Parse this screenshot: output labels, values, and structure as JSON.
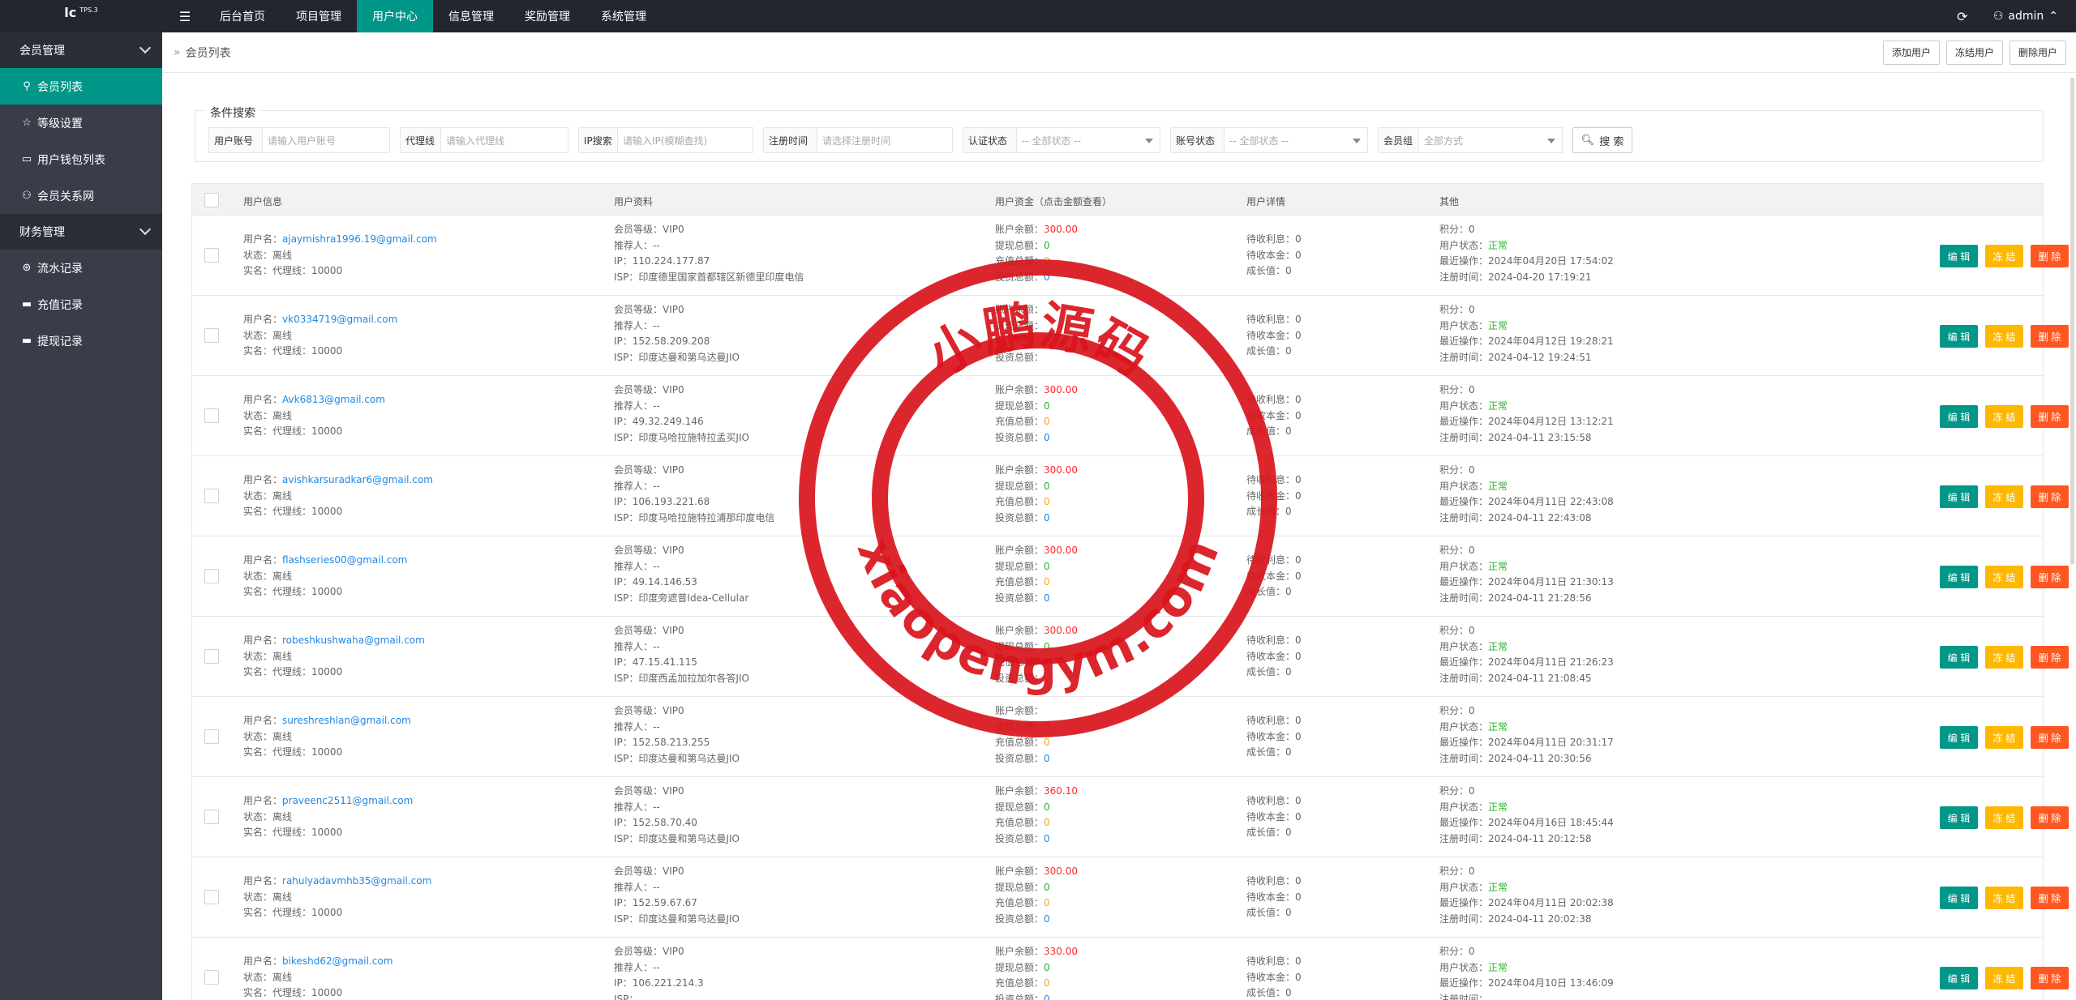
{
  "topbar": {
    "logo_text": "lc",
    "logo_version": "TPS.3",
    "menu_icon": "hamburger-icon",
    "nav": [
      "后台首页",
      "项目管理",
      "用户中心",
      "信息管理",
      "奖励管理",
      "系统管理"
    ],
    "active_nav": "用户中心",
    "user": "admin"
  },
  "sidebar": {
    "group1": "会员管理",
    "items1": [
      "会员列表",
      "等级设置",
      "用户钱包列表",
      "会员关系网"
    ],
    "group2": "财务管理",
    "items2": [
      "流水记录",
      "充值记录",
      "提现记录"
    ]
  },
  "breadcrumb": {
    "sep": "»",
    "current": "会员列表",
    "actions": [
      "添加用户",
      "冻结用户",
      "删除用户"
    ]
  },
  "search": {
    "legend": "条件搜索",
    "filters": [
      {
        "label": "用户账号",
        "placeholder": "请输入用户账号"
      },
      {
        "label": "代理线",
        "placeholder": "请输入代理线"
      },
      {
        "label": "IP搜索",
        "placeholder": "请输入IP(模糊查找)"
      },
      {
        "label": "注册时间",
        "placeholder": "请选择注册时间"
      },
      {
        "label": "认证状态",
        "placeholder": "-- 全部状态 --"
      },
      {
        "label": "账号状态",
        "placeholder": "-- 全部状态 --"
      },
      {
        "label": "会员组",
        "placeholder": "全部方式"
      }
    ],
    "button": "搜 索"
  },
  "table": {
    "headers": [
      "用户信息",
      "用户资料",
      "用户资金（点击金额查看）",
      "用户详情",
      "其他"
    ],
    "labels": {
      "username": "用户名：",
      "status": "状态：",
      "realname": "实名：",
      "agent": "代理线：",
      "level": "会员等级：",
      "referrer": "推荐人：",
      "ip": "IP：",
      "isp": "ISP：",
      "balance": "账户余额：",
      "withdraw": "提现总额：",
      "recharge": "充值总额：",
      "invest": "投资总额：",
      "interest": "待收利息：",
      "principal": "待收本金：",
      "growth": "成长值：",
      "points": "积分：",
      "user_status": "用户状态：",
      "last_op": "最近操作：",
      "reg_time": "注册时间："
    },
    "actions": {
      "edit": "编 辑",
      "freeze": "冻 结",
      "delete": "删 除"
    },
    "rows": [
      {
        "username": "ajaymishra1996.19@gmail.com",
        "status": "离线",
        "agent": "10000",
        "level": "VIP0",
        "referrer": "--",
        "ip": "110.224.177.87",
        "isp": "印度德里国家首都辖区新德里印度电信",
        "balance": "300.00",
        "withdraw": "0",
        "recharge": "0",
        "invest": "0",
        "interest": "0",
        "principal": "0",
        "growth": "0",
        "points": "0",
        "user_status": "正常",
        "last_op": "2024年04月20日 17:54:02",
        "reg_time": "2024-04-20 17:19:21"
      },
      {
        "username": "vk0334719@gmail.com",
        "status": "离线",
        "agent": "10000",
        "level": "VIP0",
        "referrer": "--",
        "ip": "152.58.209.208",
        "isp": "印度达曼和第乌达曼JIO",
        "balance": "",
        "withdraw": "",
        "recharge": "",
        "invest": "",
        "interest": "0",
        "principal": "0",
        "growth": "0",
        "points": "0",
        "user_status": "正常",
        "last_op": "2024年04月12日 19:28:21",
        "reg_time": "2024-04-12 19:24:51"
      },
      {
        "username": "Avk6813@gmail.com",
        "status": "离线",
        "agent": "10000",
        "level": "VIP0",
        "referrer": "--",
        "ip": "49.32.249.146",
        "isp": "印度马哈拉施特拉孟买JIO",
        "balance": "300.00",
        "withdraw": "0",
        "recharge": "0",
        "invest": "0",
        "interest": "0",
        "principal": "0",
        "growth": "0",
        "points": "0",
        "user_status": "正常",
        "last_op": "2024年04月12日 13:12:21",
        "reg_time": "2024-04-11 23:15:58"
      },
      {
        "username": "avishkarsuradkar6@gmail.com",
        "status": "离线",
        "agent": "10000",
        "level": "VIP0",
        "referrer": "--",
        "ip": "106.193.221.68",
        "isp": "印度马哈拉施特拉浦那印度电信",
        "balance": "300.00",
        "withdraw": "0",
        "recharge": "0",
        "invest": "0",
        "interest": "0",
        "principal": "0",
        "growth": "0",
        "points": "0",
        "user_status": "正常",
        "last_op": "2024年04月11日 22:43:08",
        "reg_time": "2024-04-11 22:43:08"
      },
      {
        "username": "flashseries00@gmail.com",
        "status": "离线",
        "agent": "10000",
        "level": "VIP0",
        "referrer": "--",
        "ip": "49.14.146.53",
        "isp": "印度旁遮普Idea-Cellular",
        "balance": "300.00",
        "withdraw": "0",
        "recharge": "0",
        "invest": "0",
        "interest": "0",
        "principal": "0",
        "growth": "0",
        "points": "0",
        "user_status": "正常",
        "last_op": "2024年04月11日 21:30:13",
        "reg_time": "2024-04-11 21:28:56"
      },
      {
        "username": "robeshkushwaha@gmail.com",
        "status": "离线",
        "agent": "10000",
        "level": "VIP0",
        "referrer": "--",
        "ip": "47.15.41.115",
        "isp": "印度西孟加拉加尔各答JIO",
        "balance": "300.00",
        "withdraw": "0",
        "recharge": "",
        "invest": "",
        "interest": "0",
        "principal": "0",
        "growth": "0",
        "points": "0",
        "user_status": "正常",
        "last_op": "2024年04月11日 21:26:23",
        "reg_time": "2024-04-11 21:08:45"
      },
      {
        "username": "sureshreshlan@gmail.com",
        "status": "离线",
        "agent": "10000",
        "level": "VIP0",
        "referrer": "--",
        "ip": "152.58.213.255",
        "isp": "印度达曼和第乌达曼JIO",
        "balance": "",
        "withdraw": "0",
        "recharge": "0",
        "invest": "0",
        "interest": "0",
        "principal": "0",
        "growth": "0",
        "points": "0",
        "user_status": "正常",
        "last_op": "2024年04月11日 20:31:17",
        "reg_time": "2024-04-11 20:30:56"
      },
      {
        "username": "praveenc2511@gmail.com",
        "status": "离线",
        "agent": "10000",
        "level": "VIP0",
        "referrer": "--",
        "ip": "152.58.70.40",
        "isp": "印度达曼和第乌达曼JIO",
        "balance": "360.10",
        "withdraw": "0",
        "recharge": "0",
        "invest": "0",
        "interest": "0",
        "principal": "0",
        "growth": "0",
        "points": "0",
        "user_status": "正常",
        "last_op": "2024年04月16日 18:45:44",
        "reg_time": "2024-04-11 20:12:58"
      },
      {
        "username": "rahulyadavmhb35@gmail.com",
        "status": "离线",
        "agent": "10000",
        "level": "VIP0",
        "referrer": "--",
        "ip": "152.59.67.67",
        "isp": "印度达曼和第乌达曼JIO",
        "balance": "300.00",
        "withdraw": "0",
        "recharge": "0",
        "invest": "0",
        "interest": "0",
        "principal": "0",
        "growth": "0",
        "points": "0",
        "user_status": "正常",
        "last_op": "2024年04月11日 20:02:38",
        "reg_time": "2024-04-11 20:02:38"
      },
      {
        "username": "bikeshd62@gmail.com",
        "status": "离线",
        "agent": "10000",
        "level": "VIP0",
        "referrer": "--",
        "ip": "106.221.214.3",
        "isp": "",
        "balance": "330.00",
        "withdraw": "0",
        "recharge": "0",
        "invest": "0",
        "interest": "0",
        "principal": "0",
        "growth": "0",
        "points": "0",
        "user_status": "正常",
        "last_op": "2024年04月10日 13:46:09",
        "reg_time": ""
      }
    ]
  },
  "watermark": {
    "top_text": "小鹏源码",
    "bottom_text": "xiaopengym.com",
    "color": "#d9141c"
  }
}
